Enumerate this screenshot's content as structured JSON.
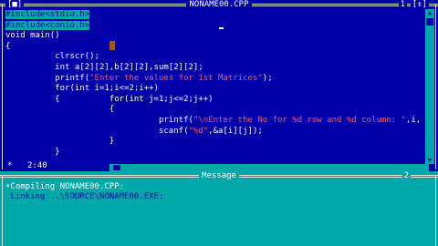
{
  "editor": {
    "title": "NONAME00.CPP",
    "close_box": "[■]",
    "window_number": "1",
    "zoom_box": "[↕]",
    "status_star": "*",
    "cursor_pos": "2:40",
    "lines": [
      {
        "type": "inc",
        "text": "#include<stdio.h>"
      },
      {
        "type": "inc",
        "text": "#include<conio.h>"
      },
      {
        "type": "plain",
        "text": "void main()"
      },
      {
        "type": "plain",
        "text": "{"
      },
      {
        "type": "plain",
        "text": "          clrscr();"
      },
      {
        "type": "plain",
        "text": "          int a[2][2],b[2][2],sum[2][2];"
      },
      {
        "type": "mixed",
        "pre": "          printf(",
        "str": "\"Enter the values for 1st Matrices\"",
        "post": ");"
      },
      {
        "type": "plain",
        "text": "          for(int i=1;i<=2;i++)"
      },
      {
        "type": "plain",
        "text": "          {          for(int j=1;j<=2;j++)"
      },
      {
        "type": "plain",
        "text": "                     {"
      },
      {
        "type": "mixed",
        "pre": "                               printf(",
        "str": "\"\\nEnter the No for %d row and %d column: \"",
        "post": ",i,"
      },
      {
        "type": "mixed",
        "pre": "                               scanf(",
        "str": "\"%d\"",
        "post": ",&a[i][j]);"
      },
      {
        "type": "plain",
        "text": "                     }"
      },
      {
        "type": "plain",
        "text": "          }"
      }
    ]
  },
  "message": {
    "title": "Message",
    "window_number": "2",
    "lines": [
      {
        "text": "•Compiling NONAME00.CPP:",
        "selected": true
      },
      {
        "text": " Linking ..\\SOURCE\\NONAME00.EXE:",
        "selected": false
      }
    ]
  }
}
